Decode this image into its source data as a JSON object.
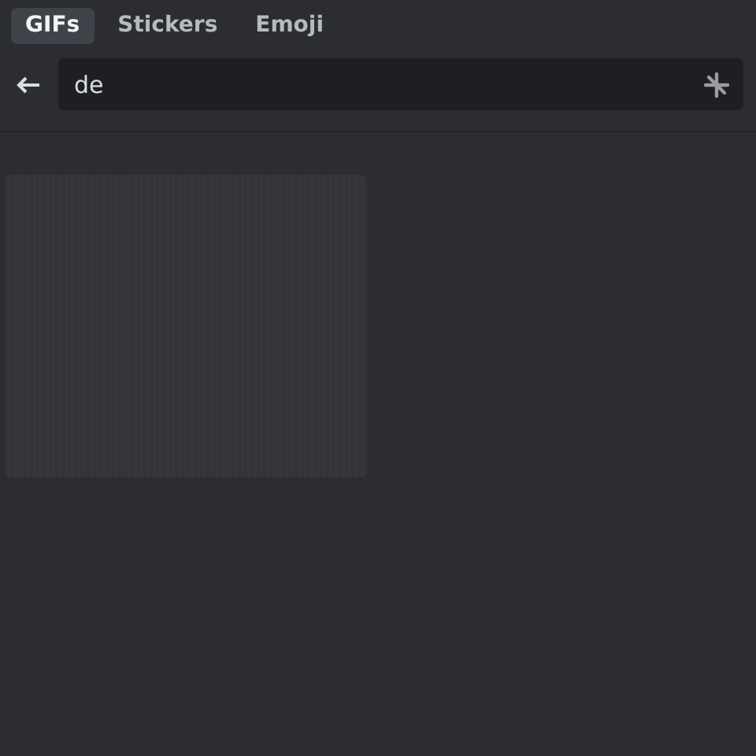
{
  "tabs": [
    {
      "label": "GIFs",
      "selected": true
    },
    {
      "label": "Stickers",
      "selected": false
    },
    {
      "label": "Emoji",
      "selected": false
    }
  ],
  "search": {
    "value": "de"
  },
  "results": [
    {
      "kind": "loading"
    }
  ]
}
